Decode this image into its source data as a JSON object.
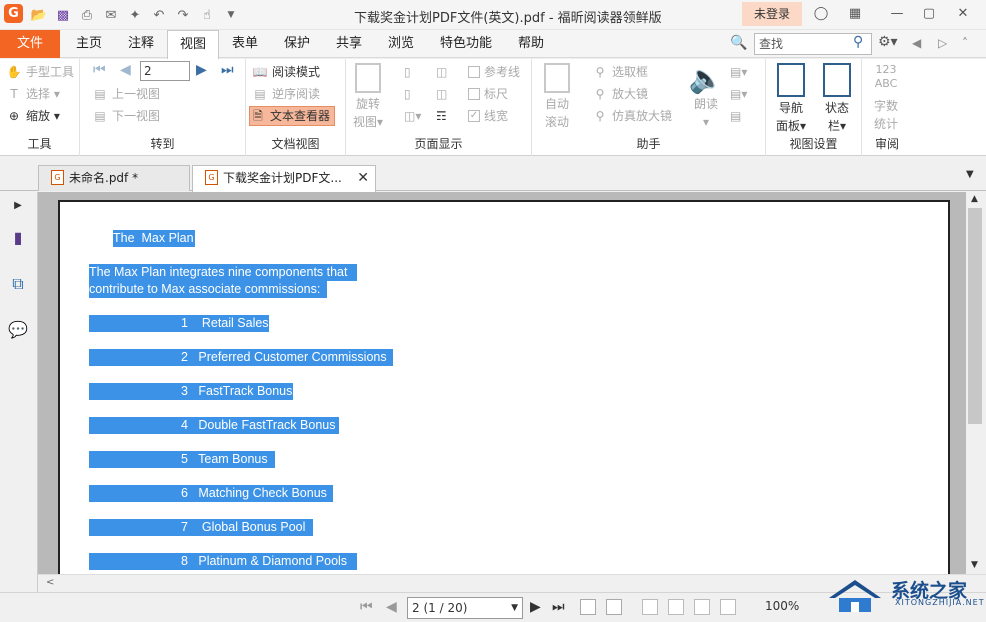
{
  "titlebar": {
    "title": "下载奖金计划PDF文件(英文).pdf - 福昕阅读器领鲜版",
    "login": "未登录"
  },
  "menu": {
    "file": "文件",
    "tabs": [
      "主页",
      "注释",
      "视图",
      "表单",
      "保护",
      "共享",
      "浏览",
      "特色功能",
      "帮助"
    ],
    "active_tab": "视图",
    "search_placeholder": "查找"
  },
  "ribbon": {
    "tools": {
      "label": "工具",
      "items": [
        "手型工具",
        "选择",
        "缩放"
      ]
    },
    "goto": {
      "label": "转到",
      "page_value": "2",
      "items": [
        "上一视图",
        "下一视图"
      ]
    },
    "docview": {
      "label": "文档视图",
      "items": [
        "阅读模式",
        "逆序阅读",
        "文本查看器"
      ],
      "rotate": "旋转",
      "rotate2": "视图"
    },
    "pagedisplay": {
      "label": "页面显示",
      "items": [
        "参考线",
        "标尺",
        "线宽"
      ]
    },
    "assistant": {
      "label": "助手",
      "autoscroll1": "自动",
      "autoscroll2": "滚动",
      "items": [
        "选取框",
        "放大镜",
        "仿真放大镜"
      ],
      "read": "朗读"
    },
    "viewsettings": {
      "label": "视图设置",
      "nav1": "导航",
      "nav2": "面板",
      "status1": "状态",
      "status2": "栏"
    },
    "review": {
      "label": "审阅",
      "wc1": "字数",
      "wc2": "统计",
      "abc": "123"
    }
  },
  "doctabs": [
    {
      "label": "未命名.pdf *"
    },
    {
      "label": "下载奖金计划PDF文..."
    }
  ],
  "document": {
    "title": "The  Max Plan",
    "intro_line1": "The Max Plan integrates nine components that",
    "intro_line2": "contribute to Max associate commissions:",
    "items": [
      "1    Retail Sales",
      "2   Preferred Customer Commissions",
      "3   FastTrack Bonus",
      "4   Double FastTrack Bonus",
      "5   Team Bonus",
      "6   Matching Check Bonus",
      "7    Global Bonus Pool",
      "8   Platinum & Diamond Pools"
    ]
  },
  "statusbar": {
    "page": "2 (1 / 20)",
    "zoom": "100%"
  },
  "watermark": {
    "text": "系统之家",
    "sub": "XITONGZHIJIA.NET"
  },
  "colors": {
    "accent": "#f26522",
    "selection": "#3c92e6"
  }
}
